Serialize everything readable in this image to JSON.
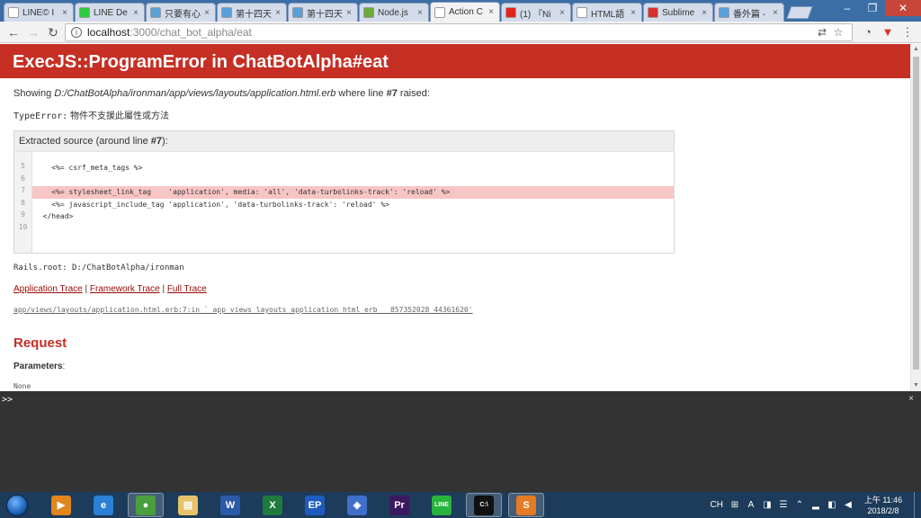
{
  "browser": {
    "tabs": [
      {
        "label": "LINE© I",
        "favicon_color": "#ffffff",
        "active": false
      },
      {
        "label": "LINE De",
        "favicon_color": "#2ecc40",
        "active": false
      },
      {
        "label": "只要有心",
        "favicon_color": "#5aa0d8",
        "active": false
      },
      {
        "label": "第十四天",
        "favicon_color": "#5aa0d8",
        "active": false
      },
      {
        "label": "第十四天",
        "favicon_color": "#5aa0d8",
        "active": false
      },
      {
        "label": "Node.js",
        "favicon_color": "#6aab3b",
        "active": false
      },
      {
        "label": "Action C",
        "favicon_color": "#ffffff",
        "active": true
      },
      {
        "label": "(1) 『Ni",
        "favicon_color": "#e62117",
        "active": false
      },
      {
        "label": "HTML語",
        "favicon_color": "#ffffff",
        "active": false
      },
      {
        "label": "Sublime",
        "favicon_color": "#d9302a",
        "active": false
      },
      {
        "label": "番外篇 -",
        "favicon_color": "#5aa0d8",
        "active": false
      }
    ],
    "url_host": "localhost",
    "url_path": ":3000/chat_bot_alpha/eat"
  },
  "error_page": {
    "title": "ExecJS::ProgramError in ChatBotAlpha#eat",
    "showing_prefix": "Showing ",
    "showing_file": "D:/ChatBotAlpha/ironman/app/views/layouts/application.html.erb",
    "showing_middle": " where line ",
    "showing_line": "#7",
    "showing_suffix": " raised:",
    "error_type": "TypeError:",
    "error_message": " 物件不支援此屬性或方法",
    "source_title_prefix": "Extracted source (around line ",
    "source_title_line": "#7",
    "source_title_suffix": "):",
    "source_lines": [
      {
        "num": "5",
        "code": "    <%= csrf_meta_tags %>",
        "highlight": false
      },
      {
        "num": "6",
        "code": "",
        "highlight": false
      },
      {
        "num": "7",
        "code": "    <%= stylesheet_link_tag    'application', media: 'all', 'data-turbolinks-track': 'reload' %>",
        "highlight": true
      },
      {
        "num": "8",
        "code": "    <%= javascript_include_tag 'application', 'data-turbolinks-track': 'reload' %>",
        "highlight": false
      },
      {
        "num": "9",
        "code": "  </head>",
        "highlight": false
      },
      {
        "num": "10",
        "code": "",
        "highlight": false
      }
    ],
    "rails_root": "Rails.root: D:/ChatBotAlpha/ironman",
    "traces": {
      "application": "Application Trace",
      "framework": "Framework Trace",
      "full": "Full Trace",
      "separator": " | "
    },
    "trace_frame": "app/views/layouts/application.html.erb:7:in `_app_views_layouts_application_html_erb___857352028_44361620'",
    "request_title": "Request",
    "parameters_label": "Parameters",
    "parameters_colon": ":",
    "parameters_value": "None"
  },
  "console": {
    "prompt": ">>",
    "close": "×"
  },
  "taskbar": {
    "apps": [
      {
        "name": "media-player",
        "label": "▶",
        "color": "#e0861c",
        "active": false
      },
      {
        "name": "internet-explorer",
        "label": "e",
        "color": "#2a7fd6",
        "active": false
      },
      {
        "name": "chrome",
        "label": "●",
        "color": "#4a9e3c",
        "active": true
      },
      {
        "name": "file-explorer",
        "label": "▤",
        "color": "#e6c36a",
        "active": false
      },
      {
        "name": "word",
        "label": "W",
        "color": "#2b5ba8",
        "active": false
      },
      {
        "name": "excel",
        "label": "X",
        "color": "#1f7a3d",
        "active": false
      },
      {
        "name": "ep-app",
        "label": "EP",
        "color": "#1e5bbf",
        "active": false
      },
      {
        "name": "diamond-app",
        "label": "◈",
        "color": "#3f6fc9",
        "active": false
      },
      {
        "name": "premiere",
        "label": "Pr",
        "color": "#3a1a5e",
        "active": false
      },
      {
        "name": "line",
        "label": "LINE",
        "color": "#27b33c",
        "active": false
      },
      {
        "name": "command-prompt",
        "label": "C:\\",
        "color": "#111111",
        "active": true
      },
      {
        "name": "sublime-text",
        "label": "S",
        "color": "#e57b22",
        "active": true
      }
    ],
    "tray_language": "CH",
    "clock_time": "上午 11:46",
    "clock_date": "2018/2/8"
  },
  "colors": {
    "header_red": "#c52f24",
    "highlight_row": "#f8c5c5",
    "link": "#980905",
    "console_bg": "#333333"
  }
}
